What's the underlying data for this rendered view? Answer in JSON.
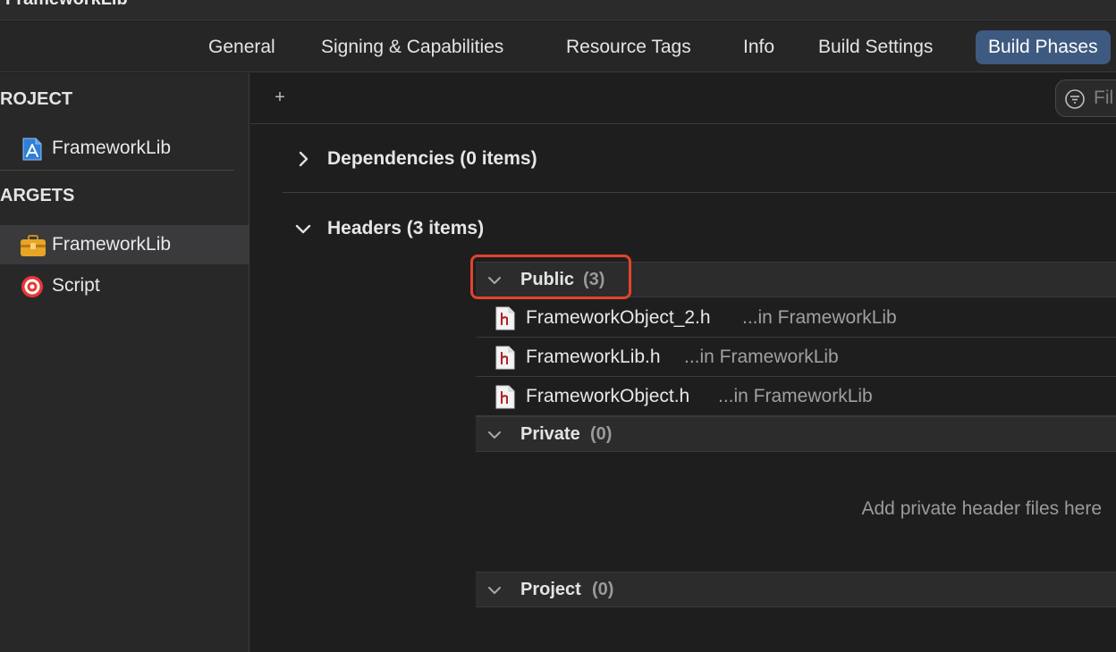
{
  "window": {
    "title": "FrameworkLib"
  },
  "tabs": [
    {
      "label": "General"
    },
    {
      "label": "Signing & Capabilities"
    },
    {
      "label": "Resource Tags"
    },
    {
      "label": "Info"
    },
    {
      "label": "Build Settings"
    },
    {
      "label": "Build Phases",
      "active": true
    }
  ],
  "sidebar": {
    "project_header": "ROJECT",
    "project_item": {
      "label": "FrameworkLib",
      "icon": "app-blueprint-icon"
    },
    "targets_header": "ARGETS",
    "targets": [
      {
        "label": "FrameworkLib",
        "icon": "toolbox-icon",
        "selected": true
      },
      {
        "label": "Script",
        "icon": "target-icon"
      }
    ]
  },
  "toolbar": {
    "add_label": "+",
    "filter_placeholder": "Fil"
  },
  "phases": {
    "dependencies": {
      "title": "Dependencies (0 items)",
      "expanded": false
    },
    "headers": {
      "title": "Headers (3 items)",
      "expanded": true,
      "public": {
        "name": "Public",
        "count": "(3)",
        "files": [
          {
            "name": "FrameworkObject_2.h",
            "location": "...in FrameworkLib"
          },
          {
            "name": "FrameworkLib.h",
            "location": "...in FrameworkLib"
          },
          {
            "name": "FrameworkObject.h",
            "location": "...in FrameworkLib"
          }
        ]
      },
      "private": {
        "name": "Private",
        "count": "(0)",
        "placeholder": "Add private header files here"
      },
      "project": {
        "name": "Project",
        "count": "(0)"
      }
    }
  },
  "colors": {
    "accent_tab": "#3f5a80",
    "highlight_box": "#e0442c",
    "header_file_icon": "#b22222"
  }
}
